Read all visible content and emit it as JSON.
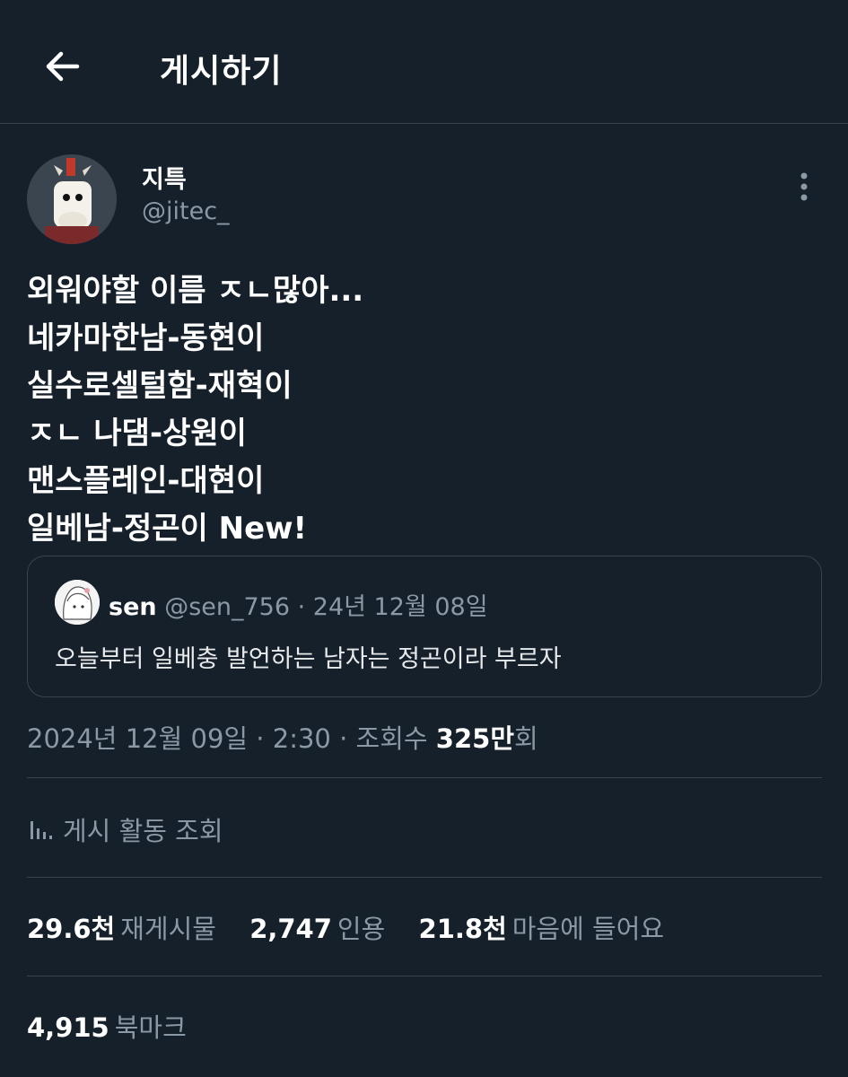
{
  "header": {
    "title": "게시하기"
  },
  "tweet": {
    "author_name": "지특",
    "author_handle": "@jitec_",
    "lines": [
      "외워야할 이름 ㅈㄴ많아...",
      "네카마한남-동현이",
      "실수로셀털함-재혁이",
      "ㅈㄴ 나댐-상원이",
      "맨스플레인-대현이",
      "일베남-정곤이 New!"
    ]
  },
  "quote": {
    "name": "sen",
    "handle": "@sen_756",
    "separator": " · ",
    "date": "24년 12월 08일",
    "text": "오늘부터 일베충 발언하는 남자는 정곤이라 부르자"
  },
  "meta": {
    "time_prefix": "2024년 12월 09일 · 2:30 · 조회수 ",
    "views_count": "325",
    "views_unit": "만",
    "views_suffix": "회"
  },
  "analytics": {
    "label": "게시 활동 조회"
  },
  "stats": [
    {
      "value": "29.6천",
      "label": "재게시물"
    },
    {
      "value": "2,747",
      "label": "인용"
    },
    {
      "value": "21.8천",
      "label": "마음에 들어요"
    }
  ],
  "bookmarks": {
    "value": "4,915",
    "label": "북마크"
  },
  "colors": {
    "background": "#15202b",
    "secondary_text": "#8b98a5",
    "divider": "#38444d"
  }
}
